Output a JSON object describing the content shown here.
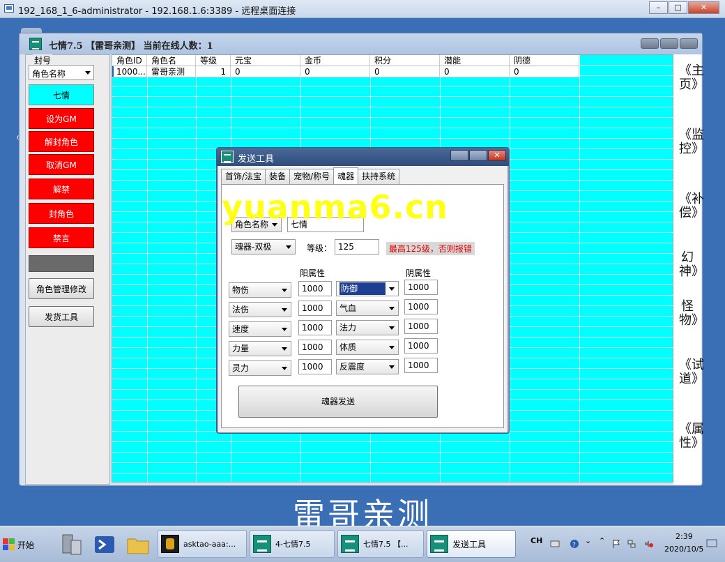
{
  "rdp": {
    "title": "192_168_1_6-administrator - 192.168.1.6:3389 - 远程桌面连接",
    "min_glyph": "–",
    "max_glyph": "□",
    "close_glyph": "✕"
  },
  "desktop": {
    "label": "dis"
  },
  "app": {
    "title": "七情7.5 【雷哥亲测】 当前在线人数：1",
    "left_panel": {
      "group_label": "封号",
      "select_value": "角色名称",
      "buttons": [
        "七情",
        "设为GM",
        "解封角色",
        "取消GM",
        "解禁",
        "封角色",
        "禁言"
      ],
      "manage_button": "角色管理修改",
      "ship_button": "发货工具"
    },
    "grid": {
      "columns": [
        "角色ID",
        "角色名",
        "等级",
        "元宝",
        "金币",
        "积分",
        "潜能",
        "阴德"
      ],
      "rows": [
        [
          "1000...",
          "雷哥亲测",
          "1",
          "0",
          "0",
          "0",
          "0",
          "0"
        ]
      ]
    },
    "right_nav": [
      "《主页》",
      "《监控》",
      "《补偿》",
      "幻神》",
      "怪物》",
      "《试道》",
      "《属性》"
    ]
  },
  "dialog": {
    "title": "发送工具",
    "close_glyph": "✕",
    "tabs": [
      "首饰/法宝",
      "装备",
      "宠物/称号",
      "魂器",
      "扶持系统"
    ],
    "active_tab": 3,
    "name_select": "角色名称",
    "name_input": "七情",
    "type_select": "魂器-双极",
    "level_label": "等级：",
    "level_value": "125",
    "warning": "最高125级，否则报错",
    "yang_header": "阳属性",
    "yin_header": "阴属性",
    "yang_attrs": [
      {
        "name": "物伤",
        "value": "1000"
      },
      {
        "name": "法伤",
        "value": "1000"
      },
      {
        "name": "速度",
        "value": "1000"
      },
      {
        "name": "力量",
        "value": "1000"
      },
      {
        "name": "灵力",
        "value": "1000"
      }
    ],
    "yin_attrs": [
      {
        "name": "防御",
        "value": "1000"
      },
      {
        "name": "气血",
        "value": "1000"
      },
      {
        "name": "法力",
        "value": "1000"
      },
      {
        "name": "体质",
        "value": "1000"
      },
      {
        "name": "反震度",
        "value": "1000"
      }
    ],
    "send_button": "魂器发送"
  },
  "watermark": "yuanma6.cn",
  "caption": "雷哥亲测",
  "taskbar": {
    "start_label": "开始",
    "tasks": [
      "asktao-aaa:...",
      "4-七情7.5",
      "七情7.5 【...",
      "发送工具"
    ],
    "lang": "CH",
    "time": "2:39",
    "date": "2020/10/5"
  },
  "colors": {
    "grid_bg": "#00ffff",
    "red_button": "#ff0000",
    "watermark": "#ffff00"
  }
}
